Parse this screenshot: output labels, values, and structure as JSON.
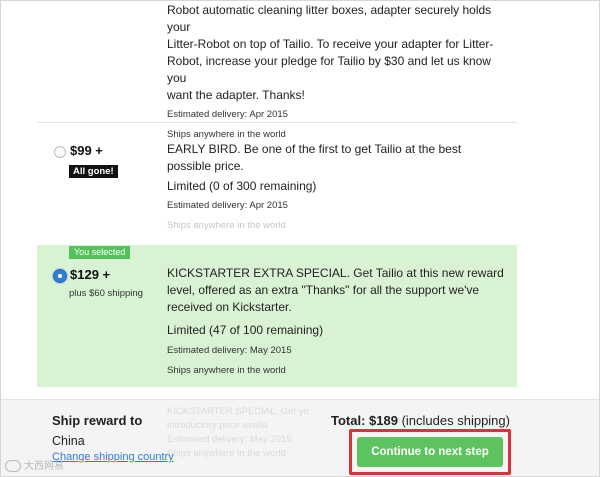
{
  "partial_reward": {
    "description_lines": [
      "Robot automatic cleaning litter boxes, adapter securely holds your",
      "Litter-Robot on top of Tailio. To receive your adapter for Litter-",
      "Robot, increase your pledge for Tailio by $30 and let us know you",
      "want the adapter. Thanks!"
    ],
    "delivery": "Estimated delivery: Apr 2015",
    "ships": "Ships anywhere in the world"
  },
  "early_bird": {
    "price": "$99 +",
    "badge": "All gone!",
    "description": "EARLY BIRD. Be one of the first to get Tailio at the best possible price.",
    "limited": "Limited (0 of 300 remaining)",
    "delivery": "Estimated delivery: Apr 2015",
    "ships": "Ships anywhere in the world"
  },
  "selected_reward": {
    "tag": "You selected",
    "price": "$129 +",
    "shipping": "plus $60 shipping",
    "description": "KICKSTARTER EXTRA SPECIAL. Get Tailio at this new reward level, offered as an extra \"Thanks\" for all the support we've received on Kickstarter.",
    "limited": "Limited (47 of 100 remaining)",
    "delivery": "Estimated delivery: May 2015",
    "ships": "Ships anywhere in the world"
  },
  "footer": {
    "ship_title": "Ship reward to",
    "country": "China",
    "change_link": "Change shipping country",
    "total_label": "Total: $189",
    "total_note": "(includes shipping)",
    "continue_label": "Continue to next step",
    "faded_lines": [
      "KICKSTARTER SPECIAL. Get yo",
      "introductory price availa",
      "Estimated delivery: May 2015",
      "Ships anywhere in the world"
    ],
    "watermark": "大西网易"
  }
}
